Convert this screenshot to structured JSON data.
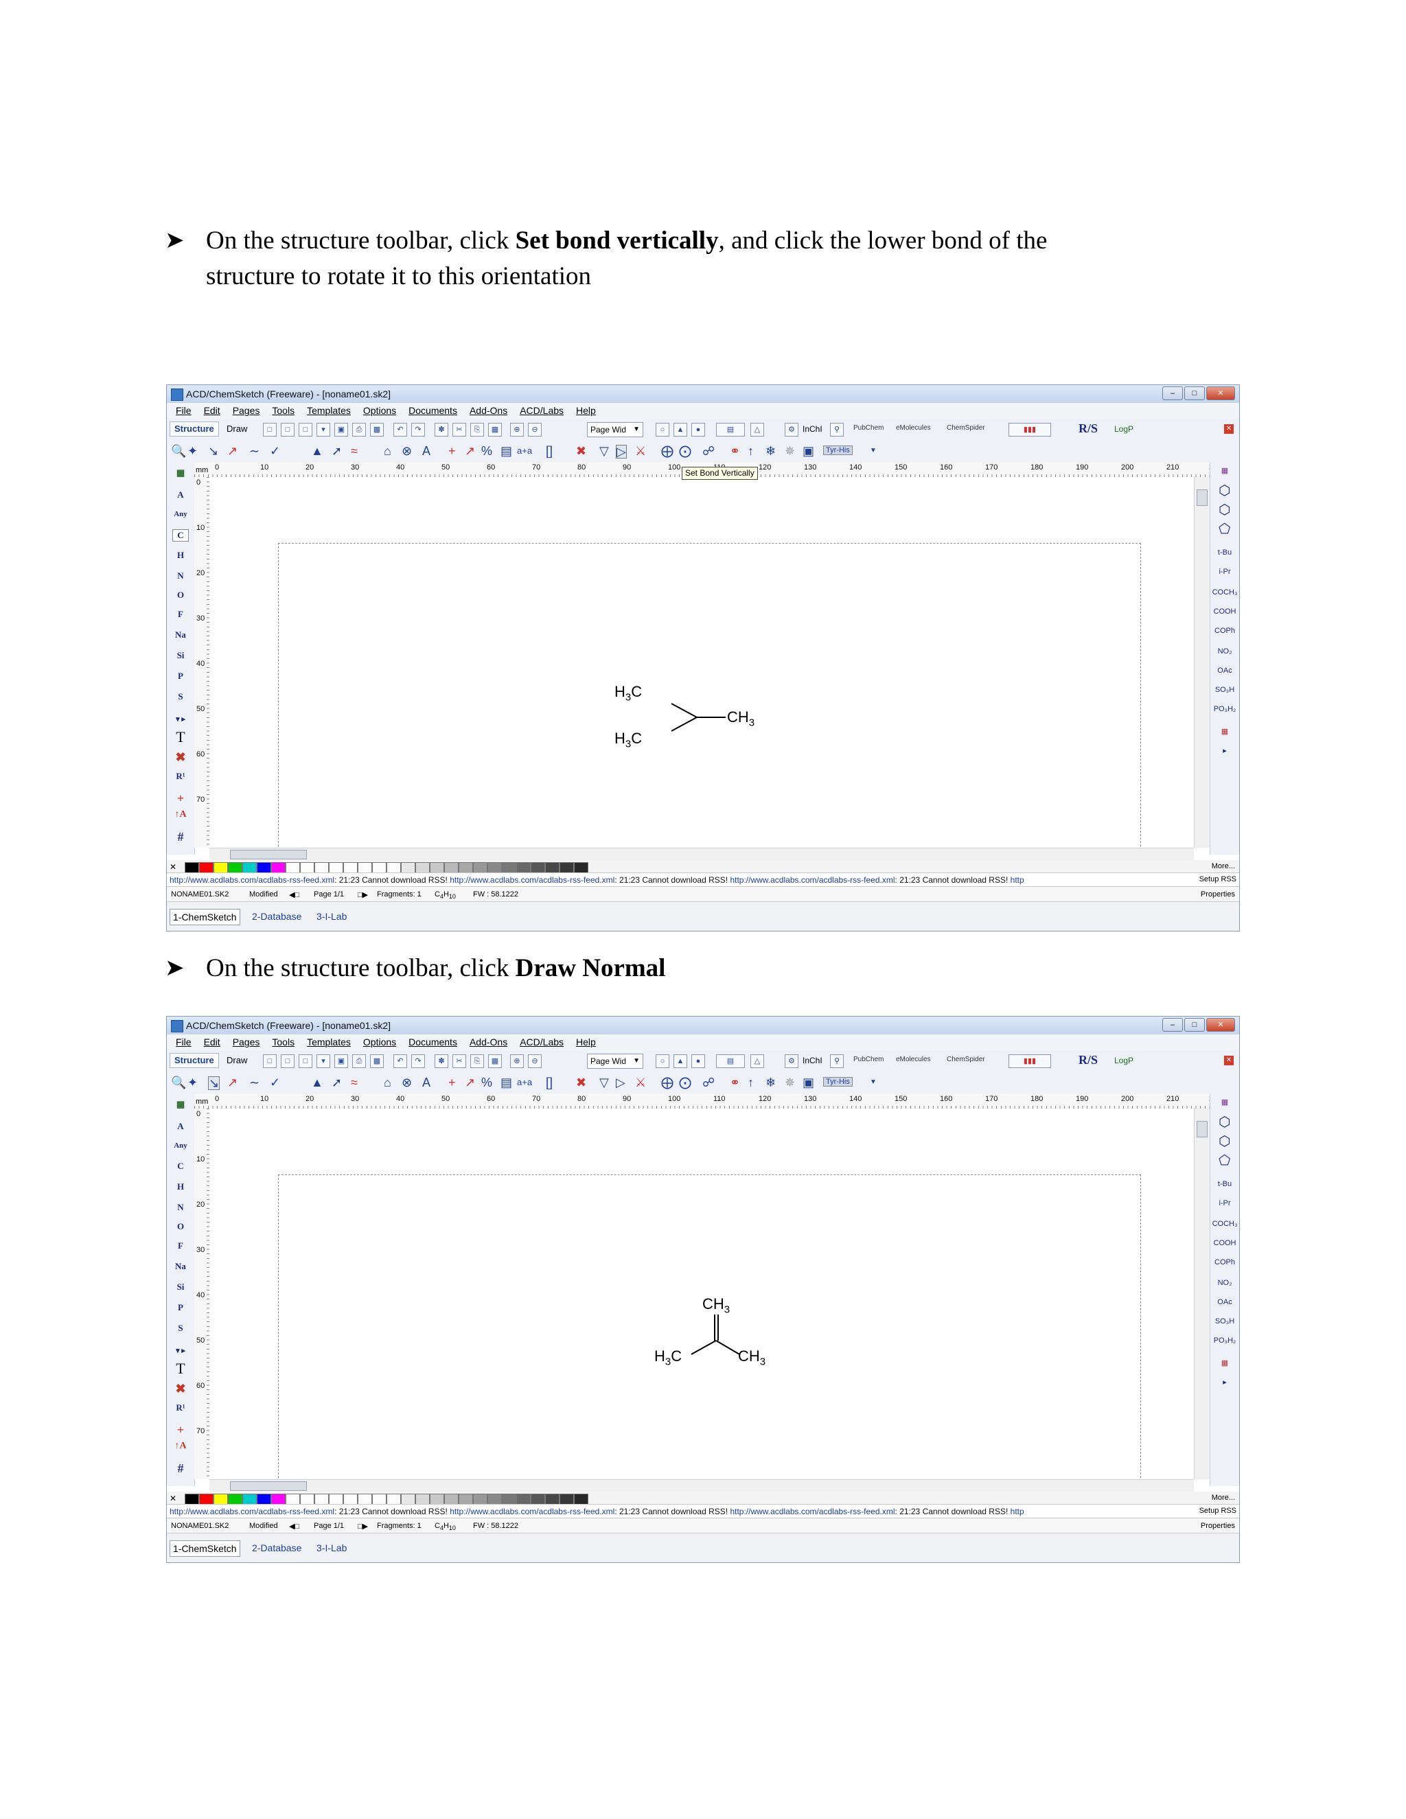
{
  "steps": [
    {
      "prefix": "On the structure toolbar, click ",
      "bold": "Set bond vertically",
      "suffix": ", and click the lower bond of the",
      "line2": "structure to rotate it to this orientation"
    },
    {
      "prefix": "On the structure toolbar, click ",
      "bold": "Draw Normal",
      "suffix": "",
      "line2": ""
    }
  ],
  "app": {
    "title": "ACD/ChemSketch (Freeware) - [noname01.sk2]",
    "menu": [
      "File",
      "Edit",
      "Pages",
      "Tools",
      "Templates",
      "Options",
      "Documents",
      "Add-Ons",
      "ACD/Labs",
      "Help"
    ],
    "mode_tabs": {
      "structure": "Structure",
      "draw": "Draw"
    },
    "zoom_select": "Page Wid",
    "toolbar_labels": {
      "rs": "R/S",
      "logp": "LogP",
      "inchi": "InChI",
      "pubchem": "PubChem",
      "emolecules": "eMolecules",
      "chemspider": "ChemSpider",
      "tautomer": "Tyr-His",
      "naming": "a+a"
    },
    "ruler_unit": "mm",
    "ruler_h_ticks": [
      "0",
      "10",
      "20",
      "30",
      "40",
      "50",
      "60",
      "70",
      "80",
      "90",
      "100",
      "110",
      "120",
      "130",
      "140",
      "150",
      "160",
      "170",
      "180",
      "190",
      "200",
      "210",
      "2"
    ],
    "ruler_v_ticks": [
      "0",
      "10",
      "20",
      "30",
      "40",
      "50",
      "60",
      "70"
    ],
    "elements": [
      "A",
      "Any",
      "C",
      "H",
      "N",
      "O",
      "F",
      "Na",
      "Si",
      "P",
      "S",
      "T",
      "R¹",
      "+",
      "#"
    ],
    "right_panel": [
      "t-Bu",
      "i-Pr",
      "COCH₃",
      "COOH",
      "COPh",
      "NO₂",
      "OAc",
      "SO₃H",
      "PO₃H₂"
    ],
    "more_label": "More...",
    "rss": {
      "url": "http://www.acdlabs.com/acdlabs-rss-feed.xml",
      "message": ": 21:23 Cannot download RSS!",
      "trailing": "http",
      "setup": "Setup RSS",
      "properties": "Properties"
    },
    "status": {
      "file": "NONAME01.SK2",
      "modified": "Modified",
      "page": "Page 1/1",
      "fragments": "Fragments: 1",
      "formula_main": "C",
      "formula_sub1": "4",
      "formula_h": "H",
      "formula_sub2": "10",
      "fw": "FW : 58.1222"
    },
    "tabs": [
      "1-ChemSketch",
      "2-Database",
      "3-I-Lab"
    ],
    "colors": {
      "titlebar": "#c2d4ee",
      "accent": "#1b3fa0",
      "tooltip_bg": "#ffffe6"
    },
    "palette": [
      "#000000",
      "#ff0000",
      "#ffff00",
      "#00cc00",
      "#00cccc",
      "#0000ff",
      "#ff00ff",
      "#ffffff",
      "#ffffff",
      "#ffffff",
      "#ffffff",
      "#ffffff",
      "#ffffff",
      "#ffffff",
      "#ffffff",
      "#e8e8e8",
      "#d8d8d8",
      "#c8c8c8",
      "#b8b8b8",
      "#a8a8a8",
      "#989898",
      "#888888",
      "#787878",
      "#686868",
      "#585858",
      "#484848",
      "#383838",
      "#282828"
    ]
  },
  "screen1": {
    "tooltip": "Set Bond Vertically",
    "labels": {
      "top_left": "H",
      "top_left_sub": "3",
      "top_left_tail": "C",
      "right": "CH",
      "right_sub": "3",
      "bottom_left": "H",
      "bottom_left_sub": "3",
      "bottom_left_tail": "C"
    }
  },
  "screen2": {
    "labels": {
      "top": "CH",
      "top_sub": "3",
      "left": "H",
      "left_sub": "3",
      "left_tail": "C",
      "right": "CH",
      "right_sub": "3"
    }
  }
}
